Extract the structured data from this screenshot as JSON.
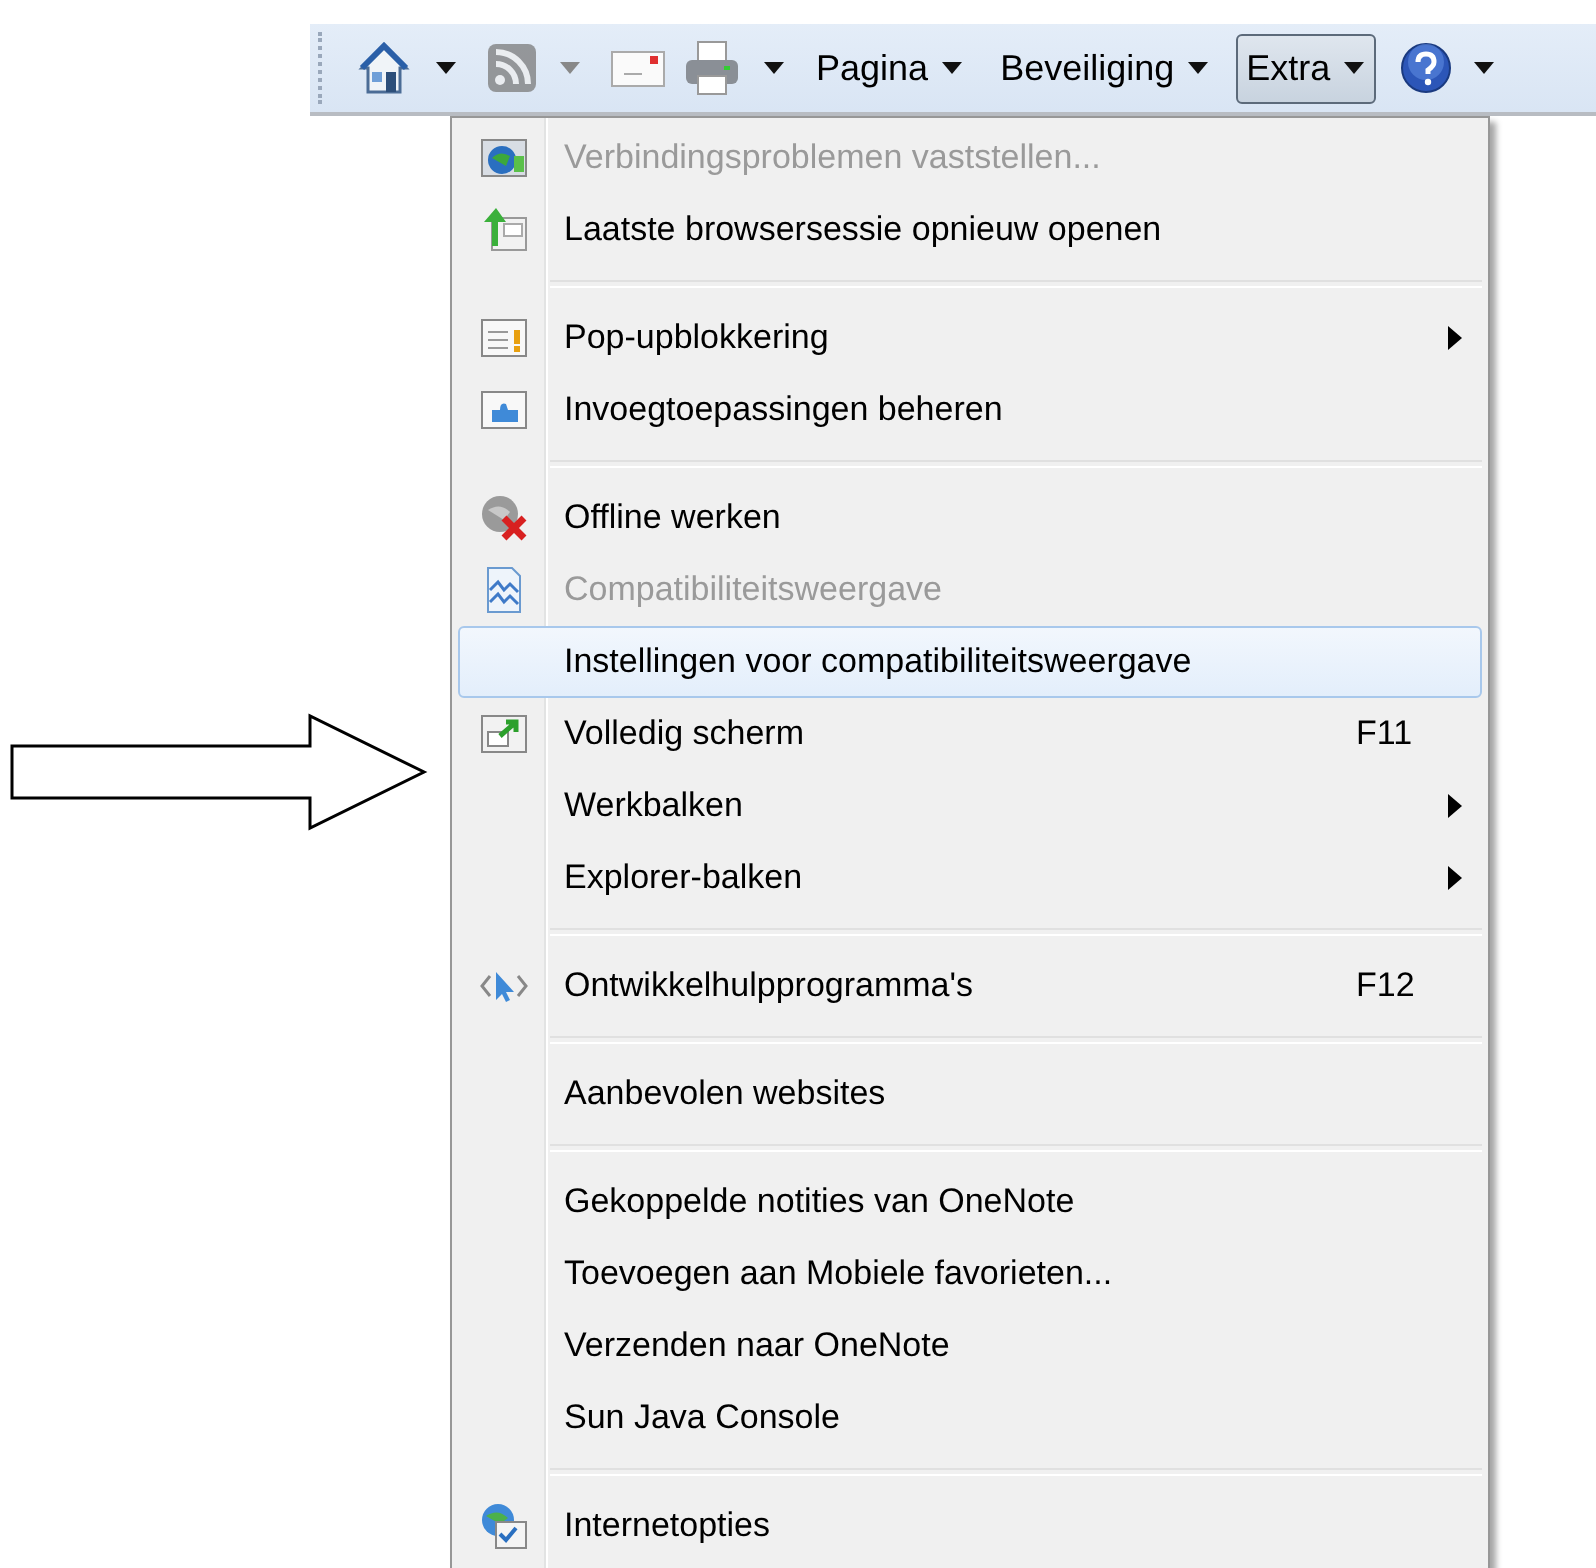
{
  "toolbar": {
    "items": [
      {
        "kind": "icon",
        "caret": true,
        "disabled": false
      },
      {
        "kind": "icon",
        "caret": true,
        "disabled": true
      },
      {
        "kind": "icon",
        "disabled": false
      },
      {
        "kind": "icon",
        "caret": true,
        "disabled": false
      },
      {
        "kind": "menu",
        "label": "Pagina",
        "selected": false
      },
      {
        "kind": "menu",
        "label": "Beveiliging",
        "selected": false
      },
      {
        "kind": "menu",
        "label": "Extra",
        "selected": true
      },
      {
        "kind": "icon",
        "caret": true,
        "disabled": false
      }
    ]
  },
  "menu": {
    "groups": [
      [
        {
          "label": "Verbindingsproblemen vaststellen...",
          "disabled": true,
          "selected": false
        },
        {
          "label": "Laatste browsersessie opnieuw openen",
          "disabled": false,
          "selected": false
        }
      ],
      [
        {
          "label": "Pop-upblokkering",
          "disabled": false,
          "selected": false,
          "submenu": true
        },
        {
          "label": "Invoegtoepassingen beheren",
          "disabled": false,
          "selected": false
        }
      ],
      [
        {
          "label": "Offline werken",
          "disabled": false,
          "selected": false
        },
        {
          "label": "Compatibiliteitsweergave",
          "disabled": true,
          "selected": false
        },
        {
          "label": "Instellingen voor compatibiliteitsweergave",
          "disabled": false,
          "selected": true
        },
        {
          "label": "Volledig scherm",
          "disabled": false,
          "selected": false,
          "shortcut": "F11"
        },
        {
          "label": "Werkbalken",
          "disabled": false,
          "selected": false,
          "submenu": true
        },
        {
          "label": "Explorer-balken",
          "disabled": false,
          "selected": false,
          "submenu": true
        }
      ],
      [
        {
          "label": "Ontwikkelhulpprogramma's",
          "disabled": false,
          "selected": false,
          "shortcut": "F12"
        }
      ],
      [
        {
          "label": "Aanbevolen websites",
          "disabled": false,
          "selected": false
        }
      ],
      [
        {
          "label": "Gekoppelde notities van OneNote",
          "disabled": false,
          "selected": false
        },
        {
          "label": "Toevoegen aan Mobiele favorieten...",
          "disabled": false,
          "selected": false
        },
        {
          "label": "Verzenden naar OneNote",
          "disabled": false,
          "selected": false
        },
        {
          "label": "Sun Java Console",
          "disabled": false,
          "selected": false
        }
      ],
      [
        {
          "label": "Internetopties",
          "disabled": false,
          "selected": false
        }
      ]
    ]
  }
}
